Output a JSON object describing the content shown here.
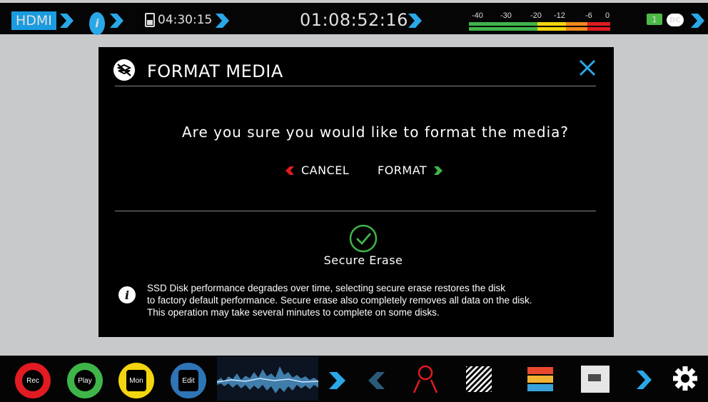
{
  "status_bar": {
    "input": "HDMI",
    "rec_remaining": "04:30:15",
    "timecode": "01:08:52:16",
    "meter_ticks": [
      "-40",
      "-30",
      "-20",
      "-12",
      "-6",
      "0"
    ],
    "battery_label": "1",
    "power_label": "DC"
  },
  "dialog": {
    "title": "FORMAT MEDIA",
    "question": "Are you sure you would like to format the media?",
    "cancel_label": "CANCEL",
    "format_label": "FORMAT",
    "secure_erase_label": "Secure Erase",
    "note_lines": [
      "SSD Disk performance degrades over time, selecting secure erase restores the disk",
      "to factory default performance. Secure erase also completely removes all data on the disk.",
      "This operation may take several minutes to complete on some disks."
    ]
  },
  "bottom_bar": {
    "modes": [
      {
        "label": "Rec",
        "color": "#e21b22"
      },
      {
        "label": "Play",
        "color": "#3fb549"
      },
      {
        "label": "Mon",
        "color": "#f3d50f"
      },
      {
        "label": "Edit",
        "color": "#2e75b6"
      }
    ]
  },
  "colors": {
    "accent": "#1b9be0",
    "cancel_red": "#e21b22",
    "format_green": "#3fb549"
  }
}
